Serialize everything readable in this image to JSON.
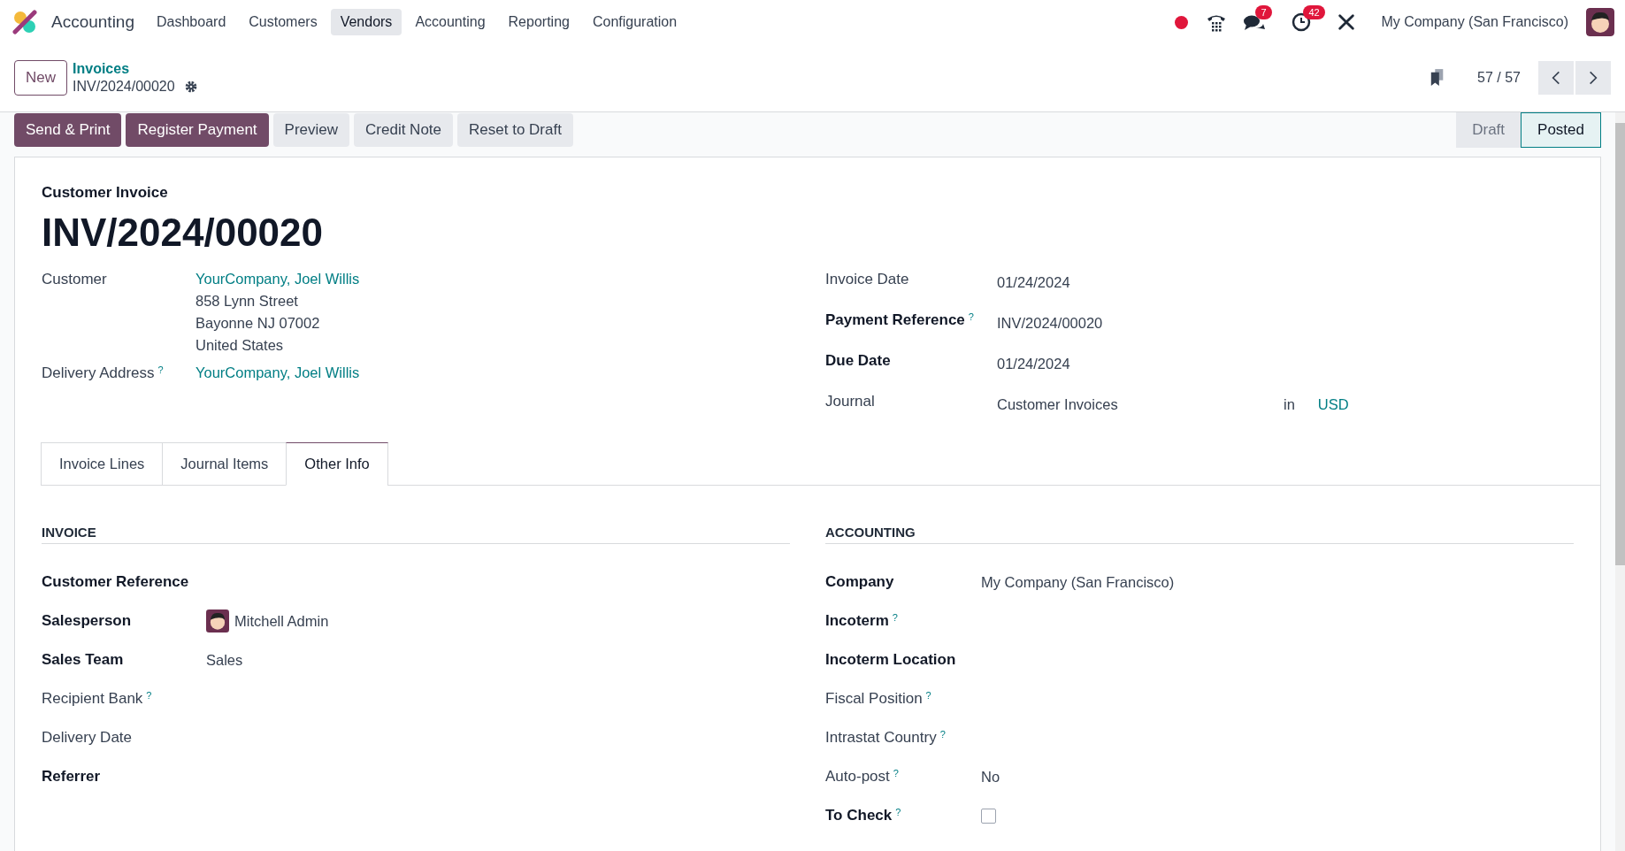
{
  "navbar": {
    "app_name": "Accounting",
    "menus": [
      {
        "label": "Dashboard",
        "selected": false
      },
      {
        "label": "Customers",
        "selected": false
      },
      {
        "label": "Vendors",
        "selected": true
      },
      {
        "label": "Accounting",
        "selected": false
      },
      {
        "label": "Reporting",
        "selected": false
      },
      {
        "label": "Configuration",
        "selected": false
      }
    ],
    "messages_badge": "7",
    "activities_badge": "42",
    "company": "My Company (San Francisco)"
  },
  "control_panel": {
    "new_button": "New",
    "breadcrumb": "Invoices",
    "record_name": "INV/2024/00020",
    "pager": "57 / 57"
  },
  "action_buttons": [
    {
      "label": "Send & Print",
      "primary": true
    },
    {
      "label": "Register Payment",
      "primary": true
    },
    {
      "label": "Preview",
      "primary": false
    },
    {
      "label": "Credit Note",
      "primary": false
    },
    {
      "label": "Reset to Draft",
      "primary": false
    }
  ],
  "status_bar": [
    {
      "label": "Draft",
      "selected": false
    },
    {
      "label": "Posted",
      "selected": true
    }
  ],
  "form": {
    "subtitle": "Customer Invoice",
    "title": "INV/2024/00020",
    "left_fields": [
      {
        "label": "Customer",
        "strong": false,
        "value_lines": [
          {
            "text": "YourCompany, Joel Willis",
            "link": true
          },
          {
            "text": "858 Lynn Street",
            "link": false
          },
          {
            "text": "Bayonne NJ 07002",
            "link": false
          },
          {
            "text": "United States",
            "link": false
          }
        ]
      },
      {
        "label": "Delivery Address",
        "help": "?",
        "strong": false,
        "value_lines": [
          {
            "text": "YourCompany, Joel Willis",
            "link": true
          }
        ]
      }
    ],
    "right_fields": [
      {
        "label": "Invoice Date",
        "strong": false,
        "value": "01/24/2024"
      },
      {
        "label": "Payment Reference",
        "help": "?",
        "strong": true,
        "value": "INV/2024/00020"
      },
      {
        "label": "Due Date",
        "strong": true,
        "value": "01/24/2024"
      },
      {
        "label": "Journal",
        "strong": false,
        "value": "Customer Invoices",
        "suffix": "in",
        "currency": "USD"
      }
    ],
    "tabs": [
      {
        "label": "Invoice Lines",
        "selected": false
      },
      {
        "label": "Journal Items",
        "selected": false
      },
      {
        "label": "Other Info",
        "selected": true
      }
    ],
    "sections": [
      {
        "title": "INVOICE",
        "fields": [
          {
            "label": "Customer Reference",
            "strong": true,
            "kind": "text"
          },
          {
            "label": "Salesperson",
            "strong": true,
            "kind": "user",
            "value": "Mitchell Admin"
          },
          {
            "label": "Sales Team",
            "strong": true,
            "kind": "text",
            "value": "Sales"
          },
          {
            "label": "Recipient Bank",
            "help": "?",
            "strong": false,
            "kind": "text"
          },
          {
            "label": "Delivery Date",
            "strong": false,
            "kind": "text"
          },
          {
            "label": "Referrer",
            "strong": true,
            "kind": "text"
          }
        ]
      },
      {
        "title": "ACCOUNTING",
        "fields": [
          {
            "label": "Company",
            "strong": true,
            "kind": "text",
            "value": "My Company (San Francisco)"
          },
          {
            "label": "Incoterm",
            "help": "?",
            "strong": true,
            "kind": "text"
          },
          {
            "label": "Incoterm Location",
            "strong": true,
            "kind": "text"
          },
          {
            "label": "Fiscal Position",
            "help": "?",
            "strong": false,
            "kind": "text"
          },
          {
            "label": "Intrastat Country",
            "help": "?",
            "strong": false,
            "kind": "text"
          },
          {
            "label": "Auto-post",
            "help": "?",
            "strong": false,
            "kind": "text",
            "value": "No"
          },
          {
            "label": "To Check",
            "help": "?",
            "strong": true,
            "kind": "checkbox",
            "checked": false
          }
        ]
      }
    ]
  }
}
